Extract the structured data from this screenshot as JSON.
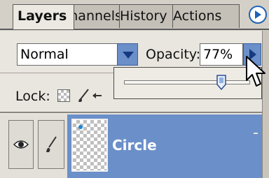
{
  "tabs": [
    {
      "label": "Layers",
      "active": true
    },
    {
      "label": "Channels"
    },
    {
      "label": "History"
    },
    {
      "label": "Actions"
    }
  ],
  "blend_mode": {
    "value": "Normal"
  },
  "opacity": {
    "label": "Opacity:",
    "value": "77%",
    "slider_level_percent": 77
  },
  "lock": {
    "label": "Lock:"
  },
  "layers": [
    {
      "name": "Circle",
      "selected": true,
      "visible": true
    }
  ],
  "colors": {
    "selection": "#6a8fc9",
    "panel": "#e9e6df",
    "accent": "#1f63b5"
  },
  "icons": [
    "panel-menu-icon",
    "dropdown-arrow-icon",
    "eye-icon",
    "brush-icon",
    "transparency-lock-icon",
    "move-lock-icon",
    "arrow-cursor-icon"
  ]
}
